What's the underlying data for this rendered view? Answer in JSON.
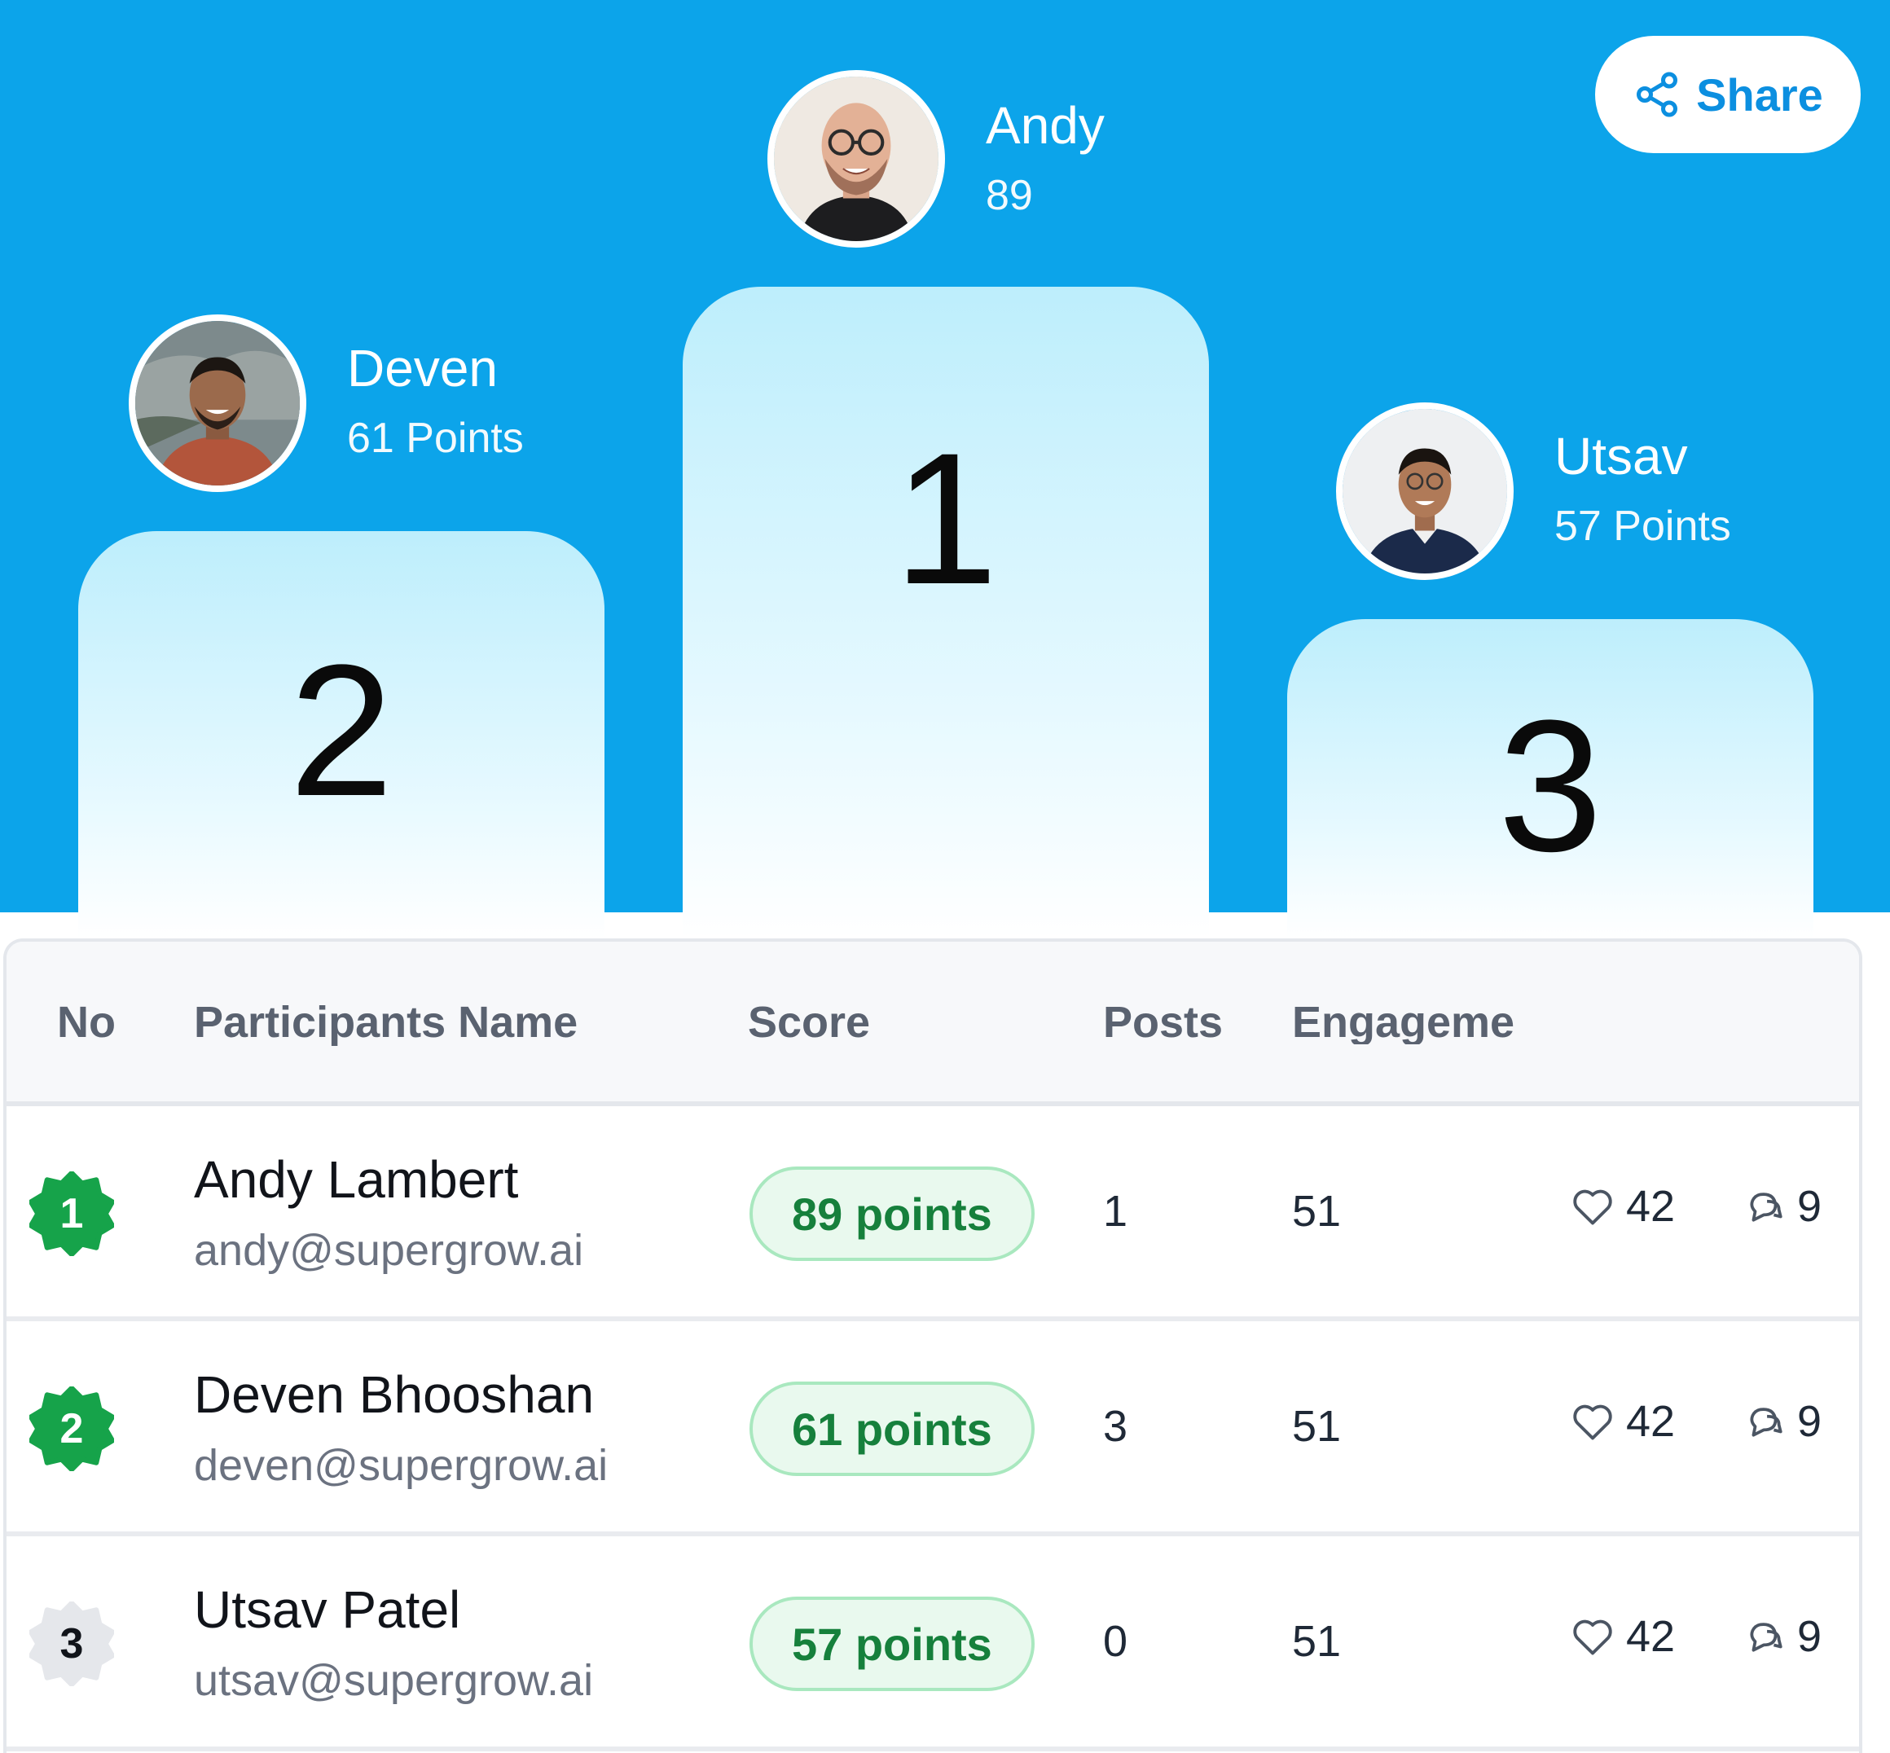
{
  "share_label": "Share",
  "podium": {
    "first": {
      "rank": "1",
      "name": "Andy",
      "points": "89"
    },
    "second": {
      "rank": "2",
      "name": "Deven",
      "points": "61 Points"
    },
    "third": {
      "rank": "3",
      "name": "Utsav",
      "points": "57 Points"
    }
  },
  "table": {
    "headers": {
      "no": "No",
      "name": "Participants Name",
      "score": "Score",
      "posts": "Posts",
      "engagement": "Engageme"
    },
    "rows": [
      {
        "no": "1",
        "name": "Andy Lambert",
        "email": "andy@supergrow.ai",
        "score": "89 points",
        "posts": "1",
        "engagement": "51",
        "likes": "42",
        "comments": "9"
      },
      {
        "no": "2",
        "name": "Deven Bhooshan",
        "email": "deven@supergrow.ai",
        "score": "61 points",
        "posts": "3",
        "engagement": "51",
        "likes": "42",
        "comments": "9"
      },
      {
        "no": "3",
        "name": "Utsav Patel",
        "email": "utsav@supergrow.ai",
        "score": "57 points",
        "posts": "0",
        "engagement": "51",
        "likes": "42",
        "comments": "9"
      }
    ]
  },
  "colors": {
    "hero_bg": "#0ca4ea",
    "accent_green": "#16803c",
    "badge_green": "#16a34a",
    "badge_gray": "#e5e7eb"
  }
}
